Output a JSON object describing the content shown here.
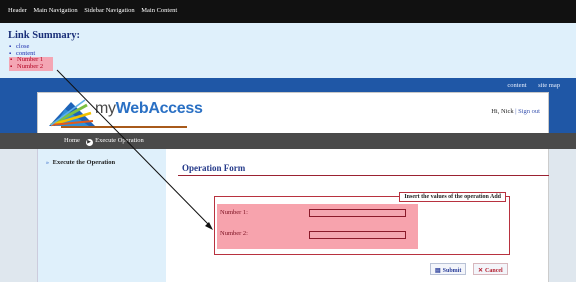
{
  "skipbar": {
    "items": [
      "Header",
      "Main Navigation",
      "Sidebar Navigation",
      "Main Content"
    ]
  },
  "summary": {
    "title": "Link Summary:",
    "links": [
      "close",
      "content"
    ],
    "highlighted": [
      "Number 1",
      "Number 2"
    ]
  },
  "toplinks": {
    "content": "content",
    "sitemap": "site map"
  },
  "logo": {
    "prefix": "my",
    "brand": "WebAccess"
  },
  "greeting": {
    "hi": "Hi, Nick",
    "sep": "|",
    "signout": "Sign out"
  },
  "breadcrumb": {
    "home": "Home",
    "current": "Execute Operation"
  },
  "sidebar": {
    "item": "Execute the Operation"
  },
  "form": {
    "title": "Operation Form",
    "legend": "Insert the values of the operation Add",
    "label1": "Number 1:",
    "label2": "Number 2:",
    "value1": "",
    "value2": "",
    "submit": "Submit",
    "cancel": "Cancel"
  },
  "colors": {
    "accent": "#1f57a6",
    "highlight": "#f7a3ad",
    "dark_bar": "#4a4a4a",
    "title": "#253a8a"
  }
}
